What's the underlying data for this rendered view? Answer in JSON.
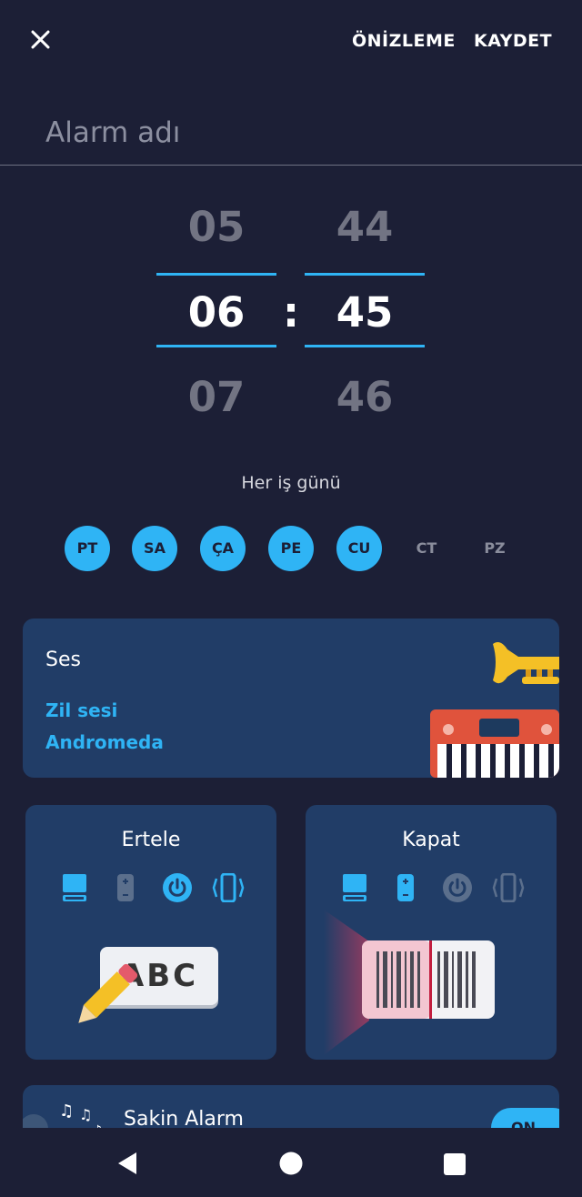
{
  "header": {
    "preview_label": "ÖNİZLEME",
    "save_label": "KAYDET"
  },
  "alarm_name": {
    "placeholder": "Alarm adı"
  },
  "time_picker": {
    "hours": {
      "prev": "05",
      "selected": "06",
      "next": "07"
    },
    "minutes": {
      "prev": "44",
      "selected": "45",
      "next": "46"
    },
    "separator": ":"
  },
  "repeat": {
    "summary": "Her iş günü",
    "days": [
      {
        "label": "PT",
        "selected": true
      },
      {
        "label": "SA",
        "selected": true
      },
      {
        "label": "ÇA",
        "selected": true
      },
      {
        "label": "PE",
        "selected": true
      },
      {
        "label": "CU",
        "selected": true
      },
      {
        "label": "CT",
        "selected": false
      },
      {
        "label": "PZ",
        "selected": false
      }
    ]
  },
  "sound": {
    "title": "Ses",
    "type_label": "Zil sesi",
    "value": "Andromeda"
  },
  "snooze": {
    "title": "Ertele",
    "method_icons": [
      "phone-icon",
      "shake-icon",
      "power-button-icon",
      "vibrate-icon"
    ],
    "active_icon": "power-button-icon",
    "illustration_text": "ABC"
  },
  "dismiss": {
    "title": "Kapat",
    "method_icons": [
      "phone-icon",
      "shake-icon",
      "power-button-icon",
      "vibrate-icon"
    ],
    "active_icons": [
      "phone-icon",
      "shake-icon"
    ]
  },
  "calm_alarm": {
    "title": "Sakin Alarm",
    "toggle_label": "ON"
  },
  "colors": {
    "background": "#1c1f36",
    "card": "#213d67",
    "accent": "#2fb4f5"
  }
}
